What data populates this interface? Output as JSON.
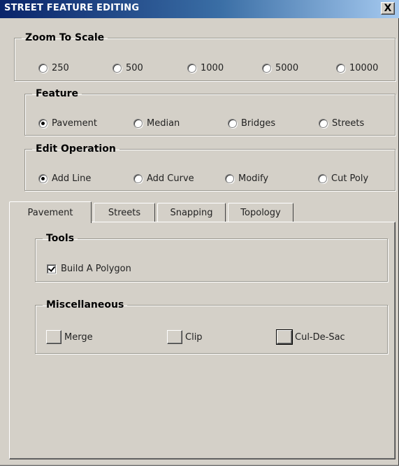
{
  "window": {
    "title": "STREET FEATURE EDITING",
    "close_glyph": "X"
  },
  "zoom": {
    "legend": "Zoom To Scale",
    "options": [
      {
        "label": "250",
        "selected": false
      },
      {
        "label": "500",
        "selected": false
      },
      {
        "label": "1000",
        "selected": false
      },
      {
        "label": "5000",
        "selected": false
      },
      {
        "label": "10000",
        "selected": false
      }
    ]
  },
  "feature": {
    "legend": "Feature",
    "options": [
      {
        "label": "Pavement",
        "selected": true
      },
      {
        "label": "Median",
        "selected": false
      },
      {
        "label": "Bridges",
        "selected": false
      },
      {
        "label": "Streets",
        "selected": false
      }
    ]
  },
  "edit_operation": {
    "legend": "Edit Operation",
    "options": [
      {
        "label": "Add Line",
        "selected": true
      },
      {
        "label": "Add Curve",
        "selected": false
      },
      {
        "label": "Modify",
        "selected": false
      },
      {
        "label": "Cut Poly",
        "selected": false
      }
    ]
  },
  "tabs": [
    {
      "label": "Pavement",
      "active": true
    },
    {
      "label": "Streets",
      "active": false
    },
    {
      "label": "Snapping",
      "active": false
    },
    {
      "label": "Topology",
      "active": false
    }
  ],
  "tools": {
    "legend": "Tools",
    "build_polygon_label": "Build A Polygon",
    "build_polygon_checked": true
  },
  "misc": {
    "legend": "Miscellaneous",
    "buttons": [
      {
        "label": "Merge"
      },
      {
        "label": "Clip"
      },
      {
        "label": "Cul-De-Sac"
      }
    ]
  }
}
